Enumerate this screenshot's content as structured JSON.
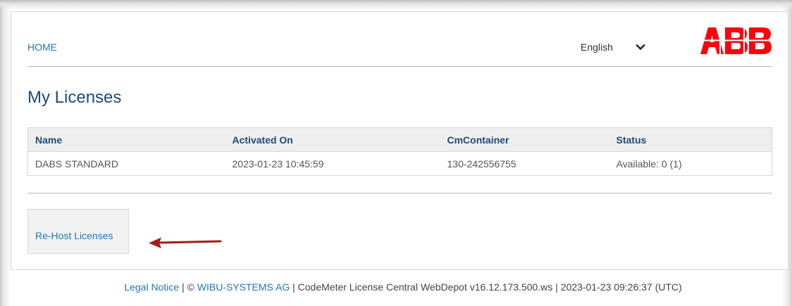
{
  "header": {
    "home_label": "HOME",
    "language": "English",
    "logo_text": "ABB",
    "brand_color": "#ff000f"
  },
  "main": {
    "title": "My Licenses",
    "table": {
      "columns": [
        "Name",
        "Activated On",
        "CmContainer",
        "Status"
      ],
      "rows": [
        {
          "name": "DABS STANDARD",
          "activated_on": "2023-01-23 10:45:59",
          "cmcontainer": "130-242556755",
          "status": "Available: 0 (1)"
        }
      ]
    },
    "rehost_label": "Re-Host Licenses",
    "annotation_arrow_color": "#a51c1c"
  },
  "footer": {
    "legal_notice": "Legal Notice",
    "separator1": " | © ",
    "company": "WIBU-SYSTEMS AG",
    "rest": " | CodeMeter License Central WebDepot v16.12.173.500.ws | 2023-01-23 09:26:37 (UTC)"
  },
  "colors": {
    "link": "#1f78b4",
    "heading": "#1e4a78",
    "table_header_bg": "#eeeeee"
  }
}
